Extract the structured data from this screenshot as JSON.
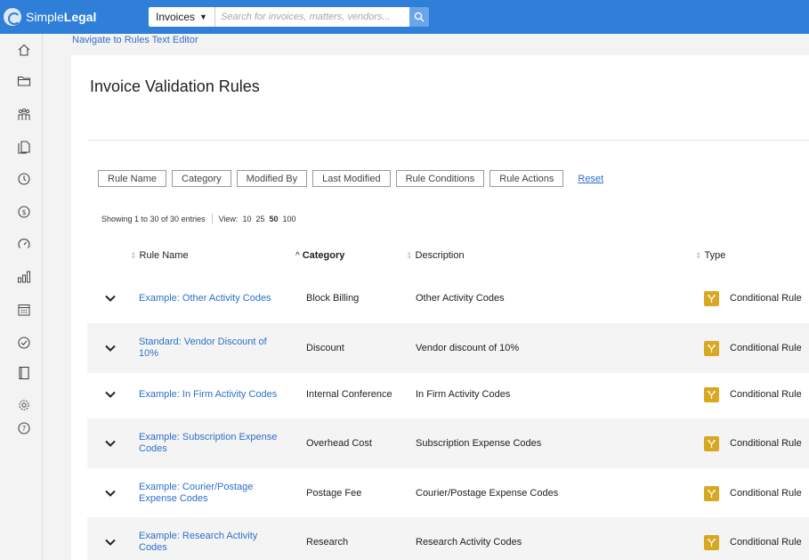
{
  "app": {
    "logo_simple": "Simple",
    "logo_legal": "Legal"
  },
  "search": {
    "scope": "Invoices",
    "placeholder": "Search for invoices, matters, vendors..."
  },
  "sidebar": {
    "items": [
      {
        "name": "home-icon"
      },
      {
        "name": "folder-icon"
      },
      {
        "name": "people-icon"
      },
      {
        "name": "documents-icon"
      },
      {
        "name": "clock-icon"
      },
      {
        "name": "dollar-icon"
      },
      {
        "name": "gauge-icon"
      },
      {
        "name": "bar-chart-icon"
      },
      {
        "name": "calendar-icon"
      },
      {
        "name": "check-circle-icon"
      },
      {
        "name": "book-icon"
      },
      {
        "name": "gear-icon"
      },
      {
        "name": "help-icon"
      }
    ]
  },
  "breadcrumb": "Navigate to Rules Text Editor",
  "page": {
    "title": "Invoice Validation Rules"
  },
  "filters": {
    "buttons": [
      "Rule Name",
      "Category",
      "Modified By",
      "Last Modified",
      "Rule Conditions",
      "Rule Actions"
    ],
    "reset": "Reset"
  },
  "info": {
    "showing": "Showing 1 to 30 of 30 entries",
    "view_label": "View:",
    "options": [
      "10",
      "25",
      "50",
      "100"
    ],
    "active_option": "50"
  },
  "table": {
    "columns": [
      "Rule Name",
      "Category",
      "Description",
      "Type"
    ],
    "sorted_column": "Category",
    "rows": [
      {
        "name": "Example: Other Activity Codes",
        "category": "Block Billing",
        "description": "Other Activity Codes",
        "type": "Conditional Rule"
      },
      {
        "name": "Standard: Vendor Discount of 10%",
        "category": "Discount",
        "description": "Vendor discount of 10%",
        "type": "Conditional Rule"
      },
      {
        "name": "Example: In Firm Activity Codes",
        "category": "Internal Conference",
        "description": "In Firm Activity Codes",
        "type": "Conditional Rule"
      },
      {
        "name": "Example: Subscription Expense Codes",
        "category": "Overhead Cost",
        "description": "Subscription Expense Codes",
        "type": "Conditional Rule"
      },
      {
        "name": "Example: Courier/Postage Expense Codes",
        "category": "Postage Fee",
        "description": "Courier/Postage Expense Codes",
        "type": "Conditional Rule"
      },
      {
        "name": "Example: Research Activity Codes",
        "category": "Research",
        "description": "Research Activity Codes",
        "type": "Conditional Rule"
      }
    ]
  },
  "colors": {
    "topbar": "#2f7fd8",
    "link": "#2e6fc7",
    "rule_icon": "#d8a823"
  }
}
